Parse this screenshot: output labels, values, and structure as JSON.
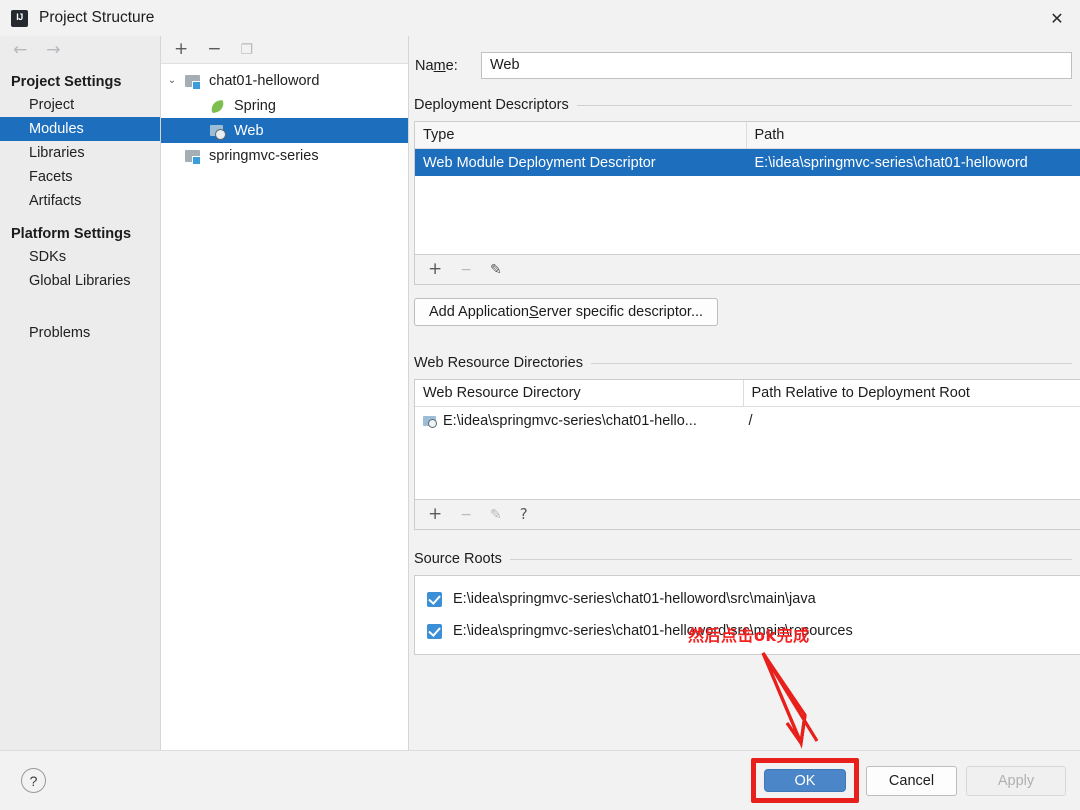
{
  "window": {
    "title": "Project Structure",
    "app_icon": "IJ",
    "close_icon": "✕"
  },
  "nav": {
    "back_icon": "←",
    "forward_icon": "→"
  },
  "sidebar": {
    "groups": [
      {
        "label": "Project Settings",
        "items": [
          {
            "label": "Project",
            "selected": false
          },
          {
            "label": "Modules",
            "selected": true
          },
          {
            "label": "Libraries",
            "selected": false
          },
          {
            "label": "Facets",
            "selected": false
          },
          {
            "label": "Artifacts",
            "selected": false
          }
        ]
      },
      {
        "label": "Platform Settings",
        "items": [
          {
            "label": "SDKs",
            "selected": false
          },
          {
            "label": "Global Libraries",
            "selected": false
          }
        ]
      }
    ],
    "problems": {
      "label": "Problems"
    }
  },
  "tree": {
    "toolbar": {
      "add": "+",
      "remove": "−",
      "copy": "❐"
    },
    "nodes": [
      {
        "label": "chat01-helloword",
        "level": 1,
        "icon": "module-icon",
        "expanded": true,
        "twisty": "⌄",
        "selected": false
      },
      {
        "label": "Spring",
        "level": 2,
        "icon": "spring-leaf-icon",
        "selected": false
      },
      {
        "label": "Web",
        "level": 2,
        "icon": "web-globe-icon",
        "selected": true
      },
      {
        "label": "springmvc-series",
        "level": 1,
        "icon": "module-icon",
        "expanded": false,
        "twisty": "",
        "selected": false
      }
    ]
  },
  "main": {
    "name_field": {
      "label_pre": "Na",
      "label_mnemonic": "m",
      "label_post": "e:",
      "value": "Web"
    },
    "deployment_descriptors": {
      "title": "Deployment Descriptors",
      "columns": [
        "Type",
        "Path"
      ],
      "rows": [
        {
          "type": "Web Module Deployment Descriptor",
          "path": "E:\\idea\\springmvc-series\\chat01-helloword",
          "selected": true
        }
      ],
      "toolbar": {
        "add": "+",
        "remove": "−",
        "edit": "✎"
      },
      "add_descriptor_button": {
        "pre": "Add Application ",
        "mnemonic": "S",
        "post": "erver specific descriptor..."
      }
    },
    "web_resource_directories": {
      "title": "Web Resource Directories",
      "columns": [
        "Web Resource Directory",
        "Path Relative to Deployment Root"
      ],
      "rows": [
        {
          "directory": "E:\\idea\\springmvc-series\\chat01-hello...",
          "relative_path": "/"
        }
      ],
      "toolbar": {
        "add": "+",
        "remove": "−",
        "edit": "✎",
        "help": "?"
      }
    },
    "source_roots": {
      "title": "Source Roots",
      "rows": [
        {
          "checked": true,
          "path": "E:\\idea\\springmvc-series\\chat01-helloword\\src\\main\\java"
        },
        {
          "checked": true,
          "path": "E:\\idea\\springmvc-series\\chat01-helloword\\src\\main\\resources"
        }
      ]
    }
  },
  "annotation": {
    "text": "然后点击ok完成",
    "color": "#f42020"
  },
  "footer": {
    "help_icon": "?",
    "ok_label": "OK",
    "cancel_label": "Cancel",
    "apply_label": "Apply",
    "ok_highlight_color": "#e8201b",
    "ok_button_color": "#4a86c8"
  }
}
